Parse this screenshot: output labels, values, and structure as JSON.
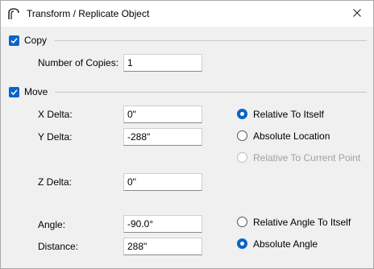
{
  "window": {
    "title": "Transform / Replicate Object"
  },
  "copy": {
    "label": "Copy",
    "checked": true,
    "number_of_copies_label": "Number of Copies:",
    "number_of_copies_value": "1"
  },
  "move": {
    "label": "Move",
    "checked": true,
    "x_delta_label": "X Delta:",
    "x_delta_value": "0\"",
    "y_delta_label": "Y Delta:",
    "y_delta_value": "-288\"",
    "z_delta_label": "Z Delta:",
    "z_delta_value": "0\"",
    "angle_label": "Angle:",
    "angle_value": "-90.0°",
    "distance_label": "Distance:",
    "distance_value": "288\""
  },
  "reference": {
    "relative_to_itself": "Relative To Itself",
    "absolute_location": "Absolute Location",
    "relative_to_current_point": "Relative To Current Point",
    "selected": "relative_to_itself"
  },
  "angle_mode": {
    "relative_angle_to_itself": "Relative Angle To Itself",
    "absolute_angle": "Absolute Angle",
    "selected": "absolute_angle"
  },
  "colors": {
    "accent": "#0a64c8",
    "disabled_text": "#a0a0a0"
  }
}
